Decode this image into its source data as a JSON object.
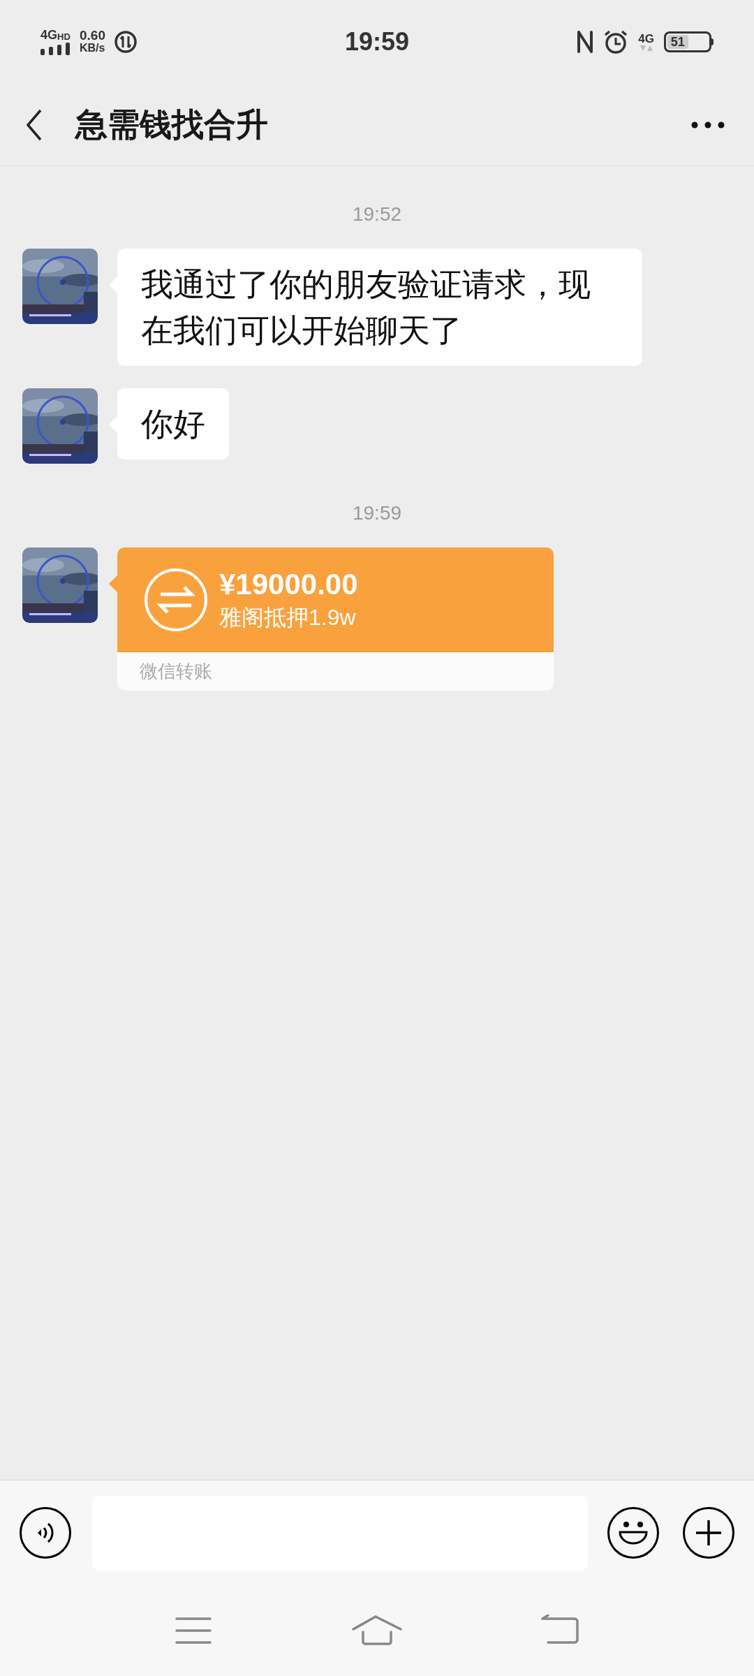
{
  "status_bar": {
    "network": "4G",
    "hd": "HD",
    "speed": "0.60",
    "speed_unit": "KB/s",
    "time": "19:59",
    "network_right": "4G",
    "battery": "51"
  },
  "header": {
    "title": "急需钱找合升"
  },
  "messages": [
    {
      "kind": "time",
      "text": "19:52"
    },
    {
      "kind": "text",
      "text": "我通过了你的朋友验证请求，现在我们可以开始聊天了"
    },
    {
      "kind": "text",
      "text": "你好"
    },
    {
      "kind": "time",
      "text": "19:59"
    },
    {
      "kind": "transfer",
      "amount": "¥19000.00",
      "note": "雅阁抵押1.9w",
      "footer": "微信转账"
    }
  ]
}
